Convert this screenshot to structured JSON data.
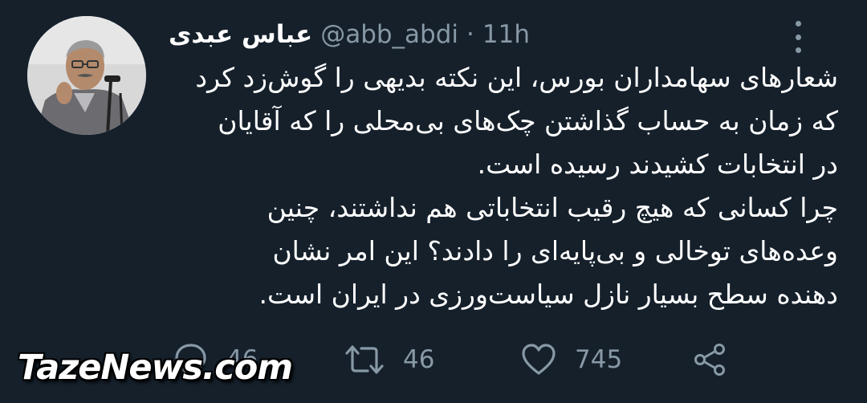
{
  "tweet": {
    "author": {
      "display_name": "عباس عبدی",
      "handle": "@abb_abdi",
      "avatar_icon": "user-photo"
    },
    "separator": "·",
    "time": "11h",
    "more_icon": "more-vertical-icon",
    "text_lines": [
      "شعارهای سهامداران بورس، این نکته بدیهی را گوش‌زد کرد",
      "که زمان به حساب گذاشتن چک‌های بی‌محلی را که آقایان",
      "در انتخابات کشیدند رسیده است.",
      "چرا کسانی که هیچ رقیب انتخاباتی هم نداشتند، چنین",
      "وعده‌های توخالی و بی‌پایه‌ای را دادند؟ این امر نشان",
      "دهنده سطح بسیار نازل سیاست‌ورزی در ایران است."
    ]
  },
  "actions": {
    "reply_count": "46",
    "retweet_count": "46",
    "like_count": "745"
  },
  "watermark": "TazeNews.com",
  "colors": {
    "background": "#15202b",
    "text": "#ffffff",
    "secondary": "#8899a6"
  }
}
